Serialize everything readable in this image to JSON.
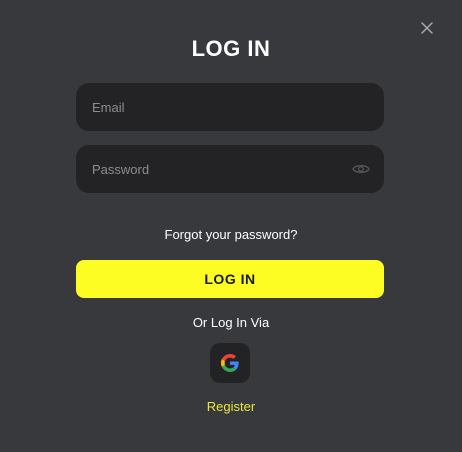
{
  "modal": {
    "title": "LOG IN",
    "close_icon": "close-icon"
  },
  "form": {
    "email": {
      "placeholder": "Email",
      "value": ""
    },
    "password": {
      "placeholder": "Password",
      "value": "",
      "icon": "eye-icon"
    },
    "forgot_label": "Forgot your password?",
    "submit_label": "LOG IN"
  },
  "social": {
    "label": "Or Log In Via",
    "providers": [
      {
        "icon": "google-icon"
      }
    ]
  },
  "register_label": "Register",
  "colors": {
    "background": "#38393d",
    "field_bg": "#232325",
    "accent": "#fdfd24",
    "register_text": "#e8e83a"
  }
}
